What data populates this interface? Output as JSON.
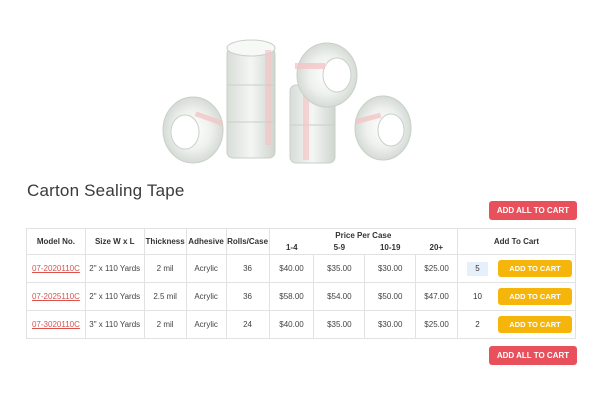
{
  "product": {
    "title": "Carton Sealing Tape",
    "image_icon": "tape-rolls-image"
  },
  "actions": {
    "add_all_label": "ADD ALL TO CART",
    "add_to_cart_label": "ADD TO CART"
  },
  "colors": {
    "add_all_bg": "#e8505b",
    "add_to_cart_bg": "#f5b50a",
    "link": "#d9534f"
  },
  "table": {
    "headers": {
      "model": "Model No.",
      "size": "Size W x L",
      "thickness": "Thickness",
      "adhesive": "Adhesive",
      "rolls": "Rolls/Case",
      "price_per_case": "Price Per Case",
      "tiers": [
        "1-4",
        "5-9",
        "10-19",
        "20+"
      ],
      "cart": "Add To Cart"
    },
    "rows": [
      {
        "model": "07-2020110C",
        "size": "2\" x 110 Yards",
        "thickness": "2 mil",
        "adhesive": "Acrylic",
        "rolls": "36",
        "prices": [
          "$40.00",
          "$35.00",
          "$30.00",
          "$25.00"
        ],
        "qty": "5"
      },
      {
        "model": "07-2025110C",
        "size": "2\" x 110 Yards",
        "thickness": "2.5 mil",
        "adhesive": "Acrylic",
        "rolls": "36",
        "prices": [
          "$58.00",
          "$54.00",
          "$50.00",
          "$47.00"
        ],
        "qty": "10"
      },
      {
        "model": "07-3020110C",
        "size": "3\" x 110 Yards",
        "thickness": "2 mil",
        "adhesive": "Acrylic",
        "rolls": "24",
        "prices": [
          "$40.00",
          "$35.00",
          "$30.00",
          "$25.00"
        ],
        "qty": "2"
      }
    ]
  }
}
